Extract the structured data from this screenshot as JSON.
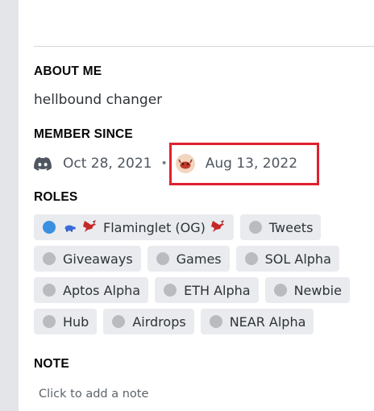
{
  "about": {
    "heading": "ABOUT ME",
    "text": "hellbound changer"
  },
  "member_since": {
    "heading": "MEMBER SINCE",
    "discord_date": "Oct 28, 2021",
    "separator": "•",
    "server_date": "Aug 13, 2022",
    "highlight_color": "#e0202f"
  },
  "roles": {
    "heading": "ROLES",
    "items": [
      {
        "label": "Flaminglet (OG)",
        "color": "#3b8fe0"
      },
      {
        "label": "Tweets",
        "color": "#b9bbbe"
      },
      {
        "label": "Giveaways",
        "color": "#b9bbbe"
      },
      {
        "label": "Games",
        "color": "#b9bbbe"
      },
      {
        "label": "SOL Alpha",
        "color": "#b9bbbe"
      },
      {
        "label": "Aptos Alpha",
        "color": "#b9bbbe"
      },
      {
        "label": "ETH Alpha",
        "color": "#b9bbbe"
      },
      {
        "label": "Newbie",
        "color": "#b9bbbe"
      },
      {
        "label": "Hub",
        "color": "#b9bbbe"
      },
      {
        "label": "Airdrops",
        "color": "#b9bbbe"
      },
      {
        "label": "NEAR Alpha",
        "color": "#b9bbbe"
      }
    ]
  },
  "note": {
    "heading": "NOTE",
    "placeholder": "Click to add a note"
  }
}
